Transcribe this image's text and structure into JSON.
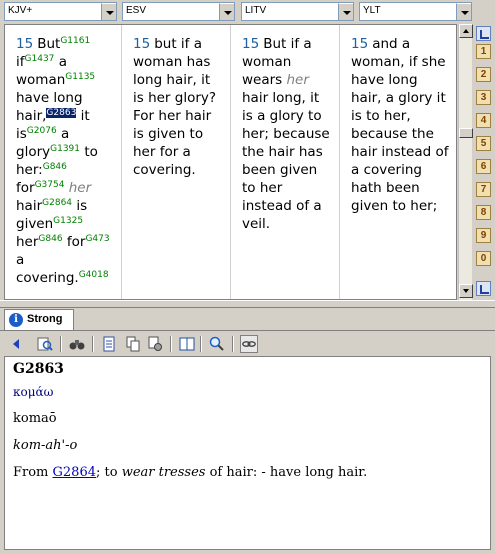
{
  "toolbar_top": {
    "versions": [
      "KJV+",
      "ESV",
      "LITV",
      "YLT"
    ]
  },
  "columns": [
    {
      "verse": "15",
      "segments": [
        {
          "t": "But",
          "s": "G1161"
        },
        {
          "t": "if",
          "s": "G1437"
        },
        {
          "t": "a woman",
          "s": "G1135"
        },
        {
          "t": "have long hair,",
          "s": "G2863",
          "selected": true
        },
        {
          "t": "it is",
          "s": "G2076"
        },
        {
          "t": "a glory",
          "s": "G1391"
        },
        {
          "t": "to her:",
          "s": "G846"
        },
        {
          "t": "for",
          "s": "G3754"
        },
        {
          "t": "her",
          "italic": true
        },
        {
          "t": "hair",
          "s": "G2864"
        },
        {
          "t": "is given",
          "s": "G1325"
        },
        {
          "t": "her",
          "s": "G846"
        },
        {
          "t": "for",
          "s": "G473"
        },
        {
          "t": "a covering.",
          "s": "G4018"
        }
      ]
    },
    {
      "verse": "15",
      "text": "but if a woman has long hair, it is her glory? For her hair is given to her for a covering."
    },
    {
      "verse": "15",
      "pre": "But if a woman wears ",
      "italic": "her",
      "post": " hair long, it is a glory to her; because the hair has been given to her instead of a veil."
    },
    {
      "verse": "15",
      "text": "and a woman, if she have long hair, a glory it is to her, because the hair instead of a covering hath been given to her;"
    }
  ],
  "sidebar": {
    "books": [
      "1",
      "2",
      "3",
      "4",
      "5",
      "6",
      "7",
      "8",
      "9",
      "0"
    ]
  },
  "panel": {
    "tab_label": "Strong",
    "entry": "G2863",
    "greek": "κομάω",
    "translit": "komaō",
    "pron": "kom-ah'-o",
    "def_prefix": "From ",
    "def_link": "G2864",
    "def_mid": "; to ",
    "def_em": "wear tresses",
    "def_suffix": " of hair: - have long hair."
  }
}
